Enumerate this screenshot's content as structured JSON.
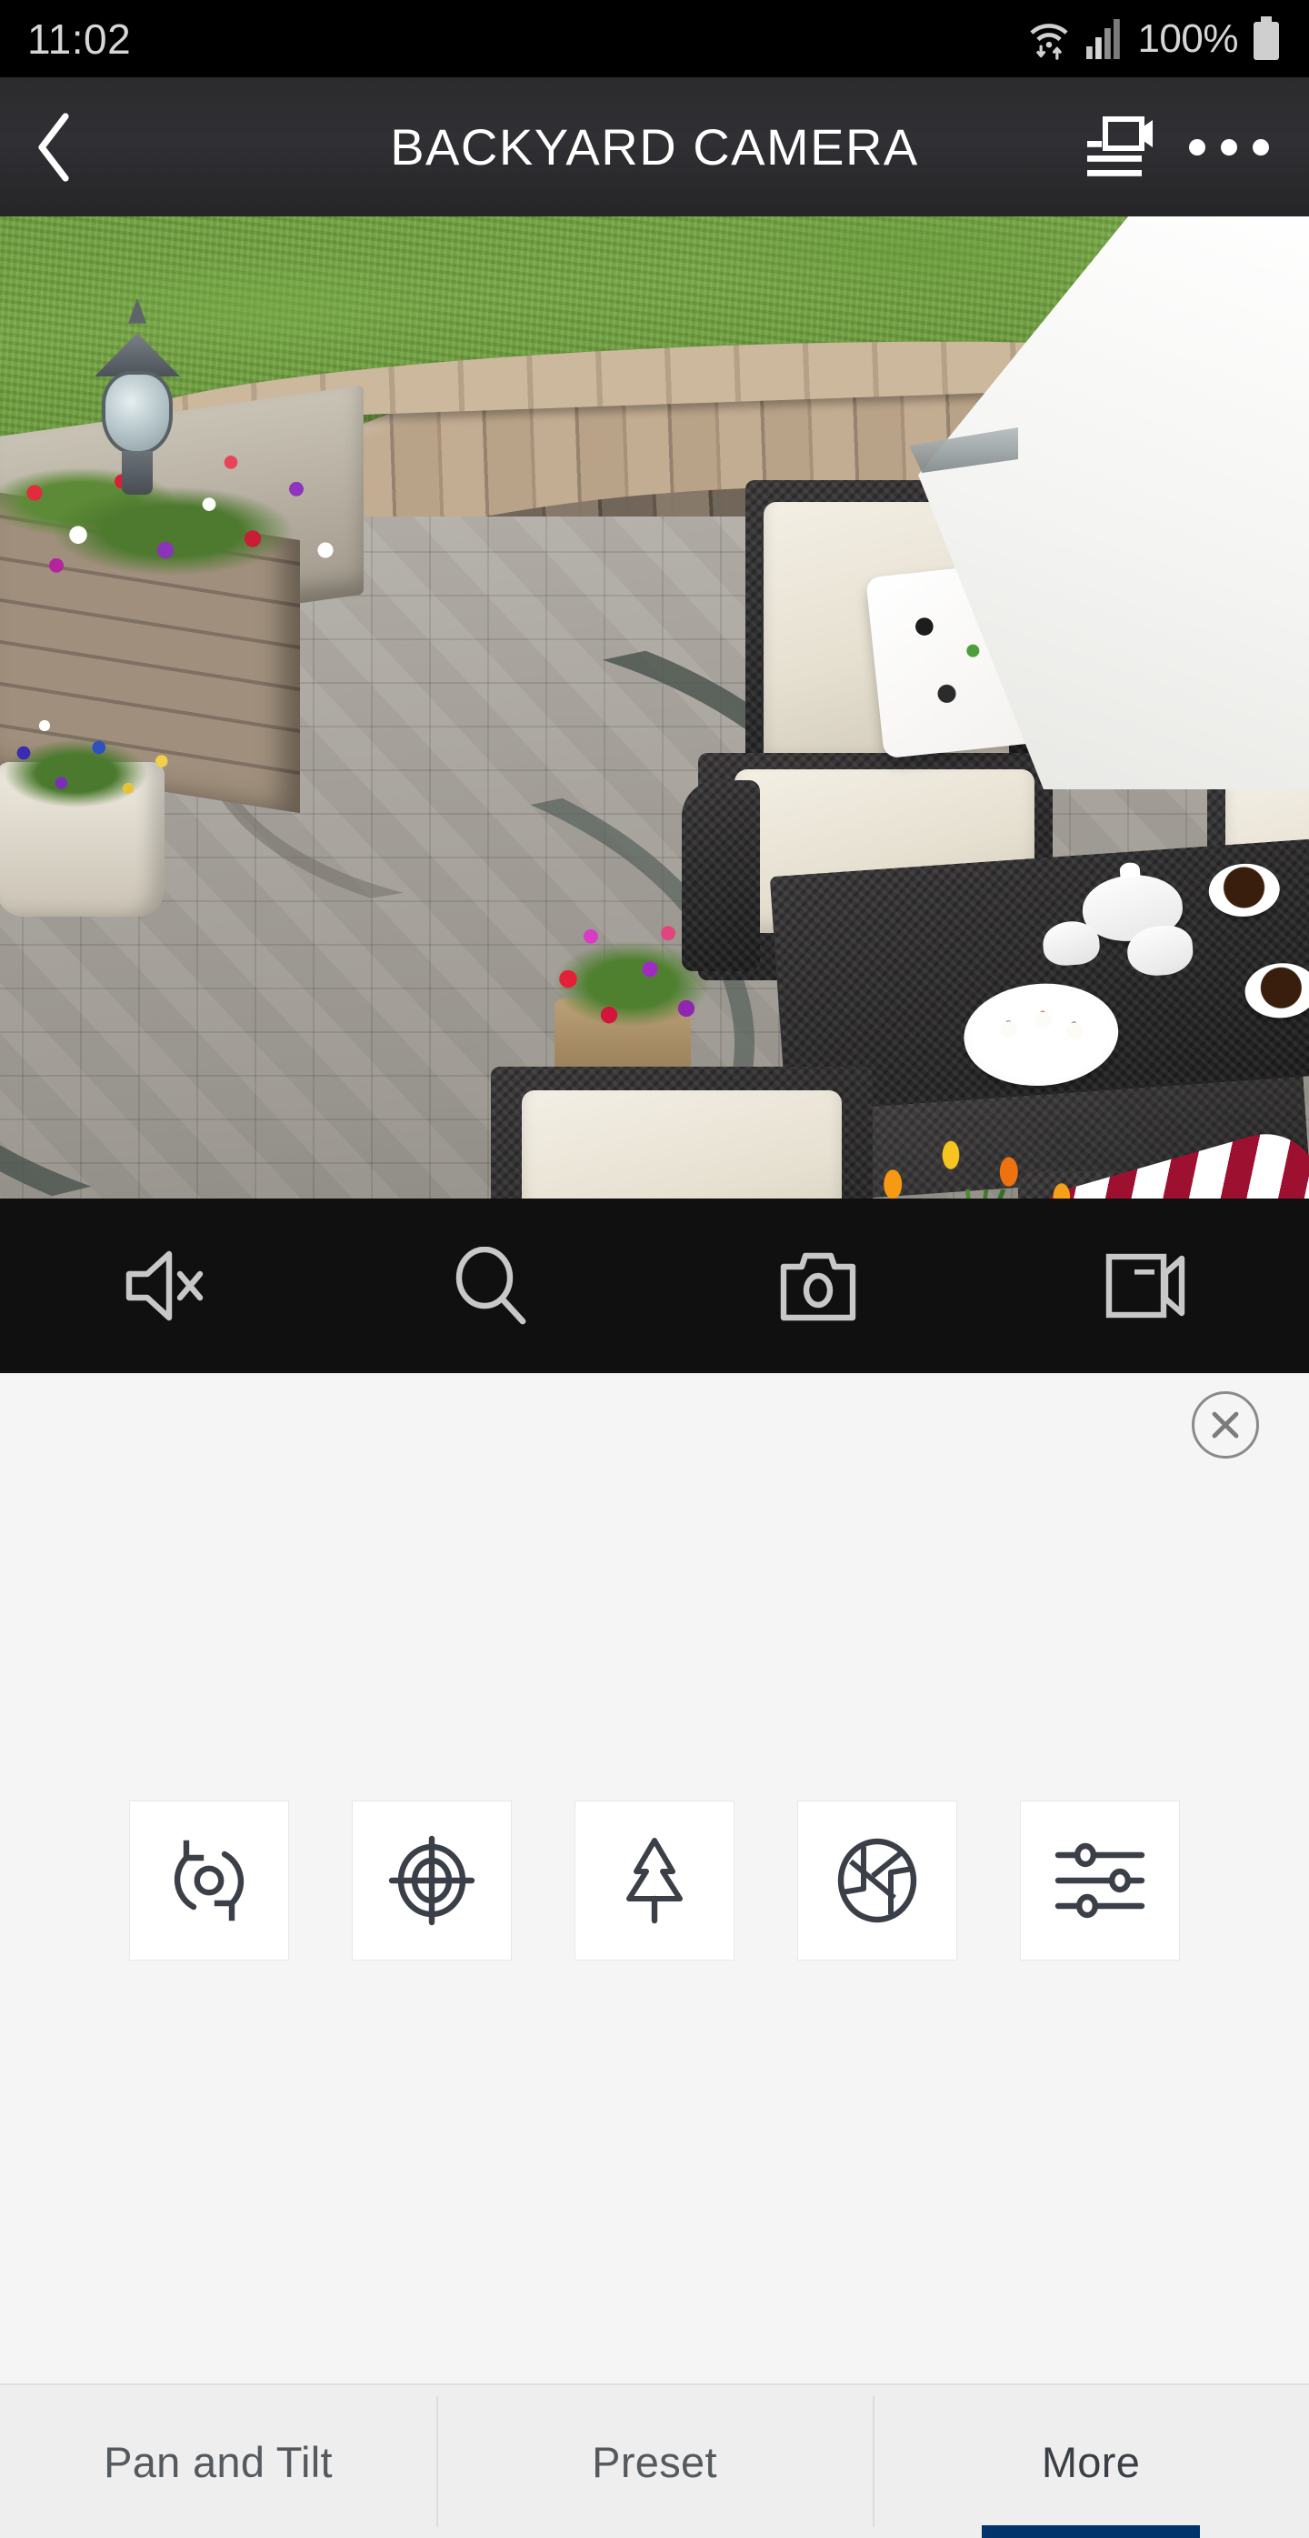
{
  "status_bar": {
    "time": "11:02",
    "battery_text": "100%",
    "icons": [
      "wifi-data-icon",
      "cellular-signal-icon",
      "battery-full-icon"
    ]
  },
  "title_bar": {
    "back_icon": "back-chevron-icon",
    "title": "BACKYARD CAMERA",
    "camera_list_icon": "camera-list-icon",
    "overflow_icon": "overflow-menu-icon"
  },
  "video": {
    "scene_description": "Live view of backyard paver patio with curved stone seat wall, black wicker furniture, tea set on coffee table, and flower planters",
    "state": "live"
  },
  "control_bar": {
    "buttons": [
      {
        "name": "mute-audio-button",
        "icon": "speaker-mute-icon",
        "label": "Mute"
      },
      {
        "name": "digital-zoom-button",
        "icon": "magnifier-icon",
        "label": "Zoom"
      },
      {
        "name": "snapshot-button",
        "icon": "photo-camera-icon",
        "label": "Snapshot"
      },
      {
        "name": "record-button",
        "icon": "video-camera-icon",
        "label": "Record"
      }
    ]
  },
  "panel": {
    "close_icon": "close-circle-icon",
    "tools": [
      {
        "name": "auto-scan-button",
        "icon": "auto-rotate-icon",
        "label": "Auto Scan"
      },
      {
        "name": "home-position-button",
        "icon": "crosshair-target-icon",
        "label": "Home Position"
      },
      {
        "name": "tree-mask-button",
        "icon": "pine-tree-icon",
        "label": "Privacy Tree"
      },
      {
        "name": "iris-button",
        "icon": "camera-aperture-icon",
        "label": "Iris"
      },
      {
        "name": "settings-button",
        "icon": "sliders-icon",
        "label": "Adjustments"
      }
    ]
  },
  "tab_bar": {
    "active_index": 2,
    "tabs": [
      {
        "label": "Pan and Tilt"
      },
      {
        "label": "Preset"
      },
      {
        "label": "More"
      }
    ],
    "indicator_color": "#00346b"
  },
  "colors": {
    "status_bar_bg": "#000000",
    "title_bar_bg": "#2f2f33",
    "control_bar_bg": "#101011",
    "panel_bg": "#f5f5f5",
    "tab_bar_bg": "#eeeeee",
    "accent": "#00346b",
    "icon_dark": "#3a3f48"
  }
}
